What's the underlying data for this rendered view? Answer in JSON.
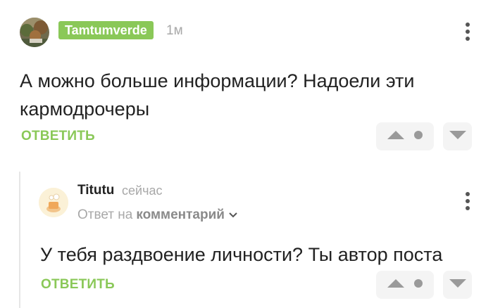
{
  "comment": {
    "author": "Tamtumverde",
    "time": "1м",
    "text": "А можно больше информации? Надоели эти кармодрочеры",
    "reply_label": "ОТВЕТИТЬ"
  },
  "reply": {
    "author": "Titutu",
    "time": "сейчас",
    "reply_to_prefix": "Ответ на",
    "reply_to_link": "комментарий",
    "text": "У тебя раздвоение личности? Ты автор поста",
    "reply_label": "ОТВЕТИТЬ"
  },
  "colors": {
    "accent": "#8ac858",
    "muted_text": "#a8a8a8",
    "button_bg": "#f4f4f4",
    "icon_gray": "#9a9a9a"
  },
  "icons": [
    "kebab-menu-icon",
    "upvote-icon",
    "rating-dot-icon",
    "downvote-icon",
    "chevron-down-icon"
  ]
}
